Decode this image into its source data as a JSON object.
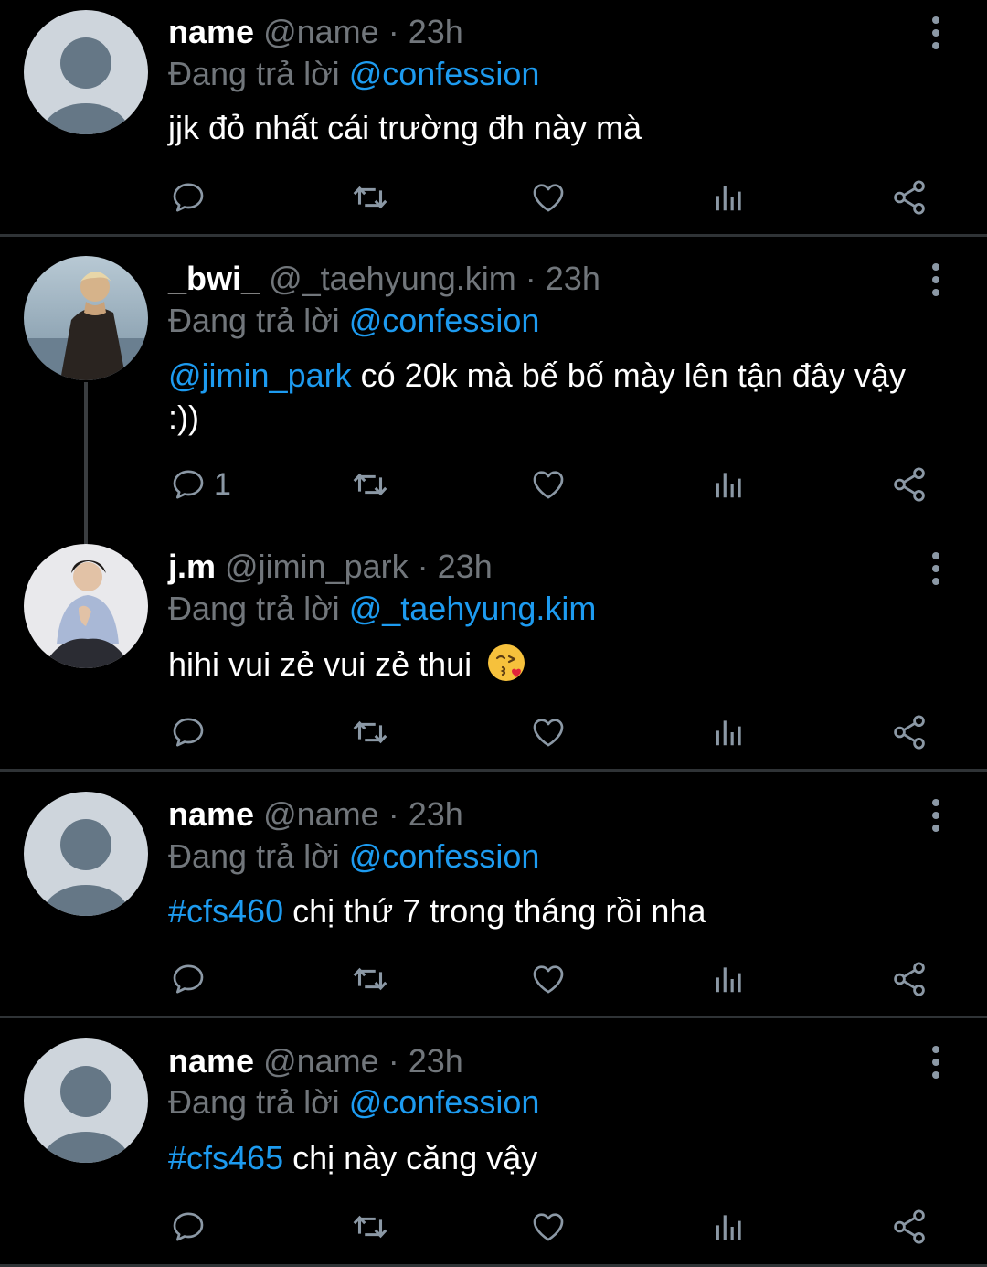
{
  "tweets": [
    {
      "name": "name",
      "handle": "@name",
      "sep": "·",
      "time": "23h",
      "reply_prefix": "Đang trả lời",
      "reply_to": "@confession",
      "text_link": "",
      "text": "jjk đỏ nhất cái trường đh này mà",
      "reply_count": "",
      "avatar": "default-avatar"
    },
    {
      "name": "_bwi_",
      "handle": "@_taehyung.kim",
      "sep": "·",
      "time": "23h",
      "reply_prefix": "Đang trả lời",
      "reply_to": "@confession",
      "text_link": "@jimin_park",
      "text": " có 20k mà bế bố mày lên tận đây vậy :))",
      "reply_count": "1",
      "avatar": "photo-avatar"
    },
    {
      "name": "j.m",
      "handle": "@jimin_park",
      "sep": "·",
      "time": "23h",
      "reply_prefix": "Đang trả lời",
      "reply_to": "@_taehyung.kim",
      "text_link": "",
      "text": "hihi vui zẻ vui zẻ thui",
      "reply_count": "",
      "emoji": "kissing-face-emoji",
      "avatar": "photo-avatar"
    },
    {
      "name": "name",
      "handle": "@name",
      "sep": "·",
      "time": "23h",
      "reply_prefix": "Đang trả lời",
      "reply_to": "@confession",
      "text_link": "#cfs460",
      "text": " chị thứ 7 trong tháng rồi nha",
      "reply_count": "",
      "avatar": "default-avatar"
    },
    {
      "name": "name",
      "handle": "@name",
      "sep": "·",
      "time": "23h",
      "reply_prefix": "Đang trả lời",
      "reply_to": "@confession",
      "text_link": "#cfs465",
      "text": " chị này căng vậy",
      "reply_count": "",
      "avatar": "default-avatar"
    }
  ],
  "icons": {
    "reply": "reply-icon",
    "retweet": "retweet-icon",
    "like": "like-icon",
    "views": "views-icon",
    "share": "share-icon",
    "more": "more-icon"
  },
  "colors": {
    "background": "#000000",
    "link": "#1d9bf0",
    "muted": "#71767b",
    "divider": "#2f3336"
  }
}
